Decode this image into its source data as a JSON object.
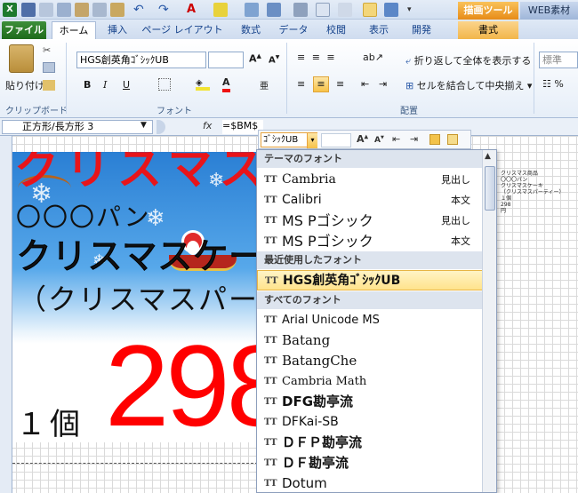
{
  "ribbon_tabs": {
    "file": "ファイル",
    "home": "ホーム",
    "insert": "挿入",
    "page_layout": "ページ レイアウト",
    "formulas": "数式",
    "data": "データ",
    "review": "校閲",
    "view": "表示",
    "developer": "開発",
    "format": "書式",
    "drawing_tools": "描画ツール",
    "web_material": "WEB素材"
  },
  "ribbon": {
    "paste_label": "貼り付け",
    "clipboard_group": "クリップボード",
    "font_group": "フォント",
    "alignment_group": "配置",
    "font_name": "HGS創英角ｺﾞｼｯｸUB",
    "wrap_text": "折り返して全体を表示する",
    "merge_center": "セルを結合して中央揃え",
    "number_format": "標準"
  },
  "formula_bar": {
    "name_box": "正方形/長方形 3",
    "fx": "fx",
    "formula": "=$BM$"
  },
  "mini_toolbar": {
    "font_value": "ｺﾞｼｯｸUB"
  },
  "poster": {
    "line1": "クリスマス",
    "line2": "〇〇〇パン",
    "line3": "クリスマスケー",
    "line4": "（クリスマスパーテ",
    "price": "298",
    "unit": "１個"
  },
  "font_dropdown": {
    "sections": {
      "theme": "テーマのフォント",
      "recent": "最近使用したフォント",
      "all": "すべてのフォント"
    },
    "theme_fonts": [
      {
        "name": "Cambria",
        "tag": "見出し"
      },
      {
        "name": "Calibri",
        "tag": "本文"
      },
      {
        "name": "MS Pゴシック",
        "tag": "見出し"
      },
      {
        "name": "MS Pゴシック",
        "tag": "本文"
      }
    ],
    "recent_fonts": [
      {
        "name": "HGS創英角ｺﾞｼｯｸUB"
      }
    ],
    "all_fonts": [
      {
        "name": "Arial Unicode MS"
      },
      {
        "name": "Batang"
      },
      {
        "name": "BatangChe"
      },
      {
        "name": "Cambria Math"
      },
      {
        "name": "DFG勘亭流"
      },
      {
        "name": "DFKai-SB"
      },
      {
        "name": "ＤＦＰ勘亭流"
      },
      {
        "name": "ＤＦ勘亭流"
      },
      {
        "name": "Dotum"
      }
    ]
  },
  "mini_sheet": "クリスマス商品\n〇〇〇パン\nクリスマスケーキ\n（クリスマスパーティー）\n１個\n298\n円"
}
